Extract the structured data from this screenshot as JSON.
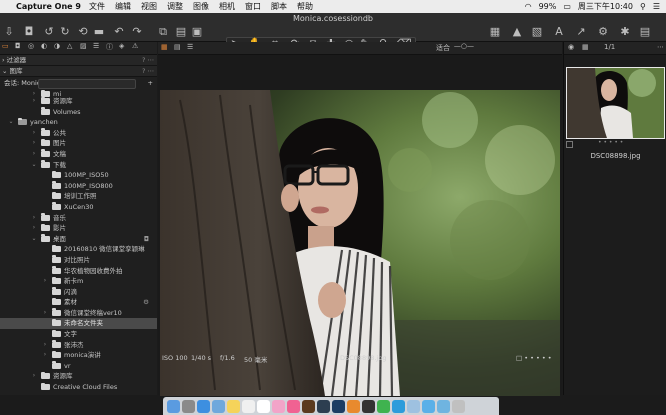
{
  "menubar": {
    "app_name": "Capture One 9",
    "items": [
      "文件",
      "编辑",
      "视图",
      "调整",
      "图像",
      "相机",
      "窗口",
      "脚本",
      "帮助"
    ],
    "battery": "99%",
    "clock": "周三下午10:40"
  },
  "window": {
    "title": "Monica.cosessiondb"
  },
  "tabbar": {
    "zoom_label": "适合",
    "counter": "1/1"
  },
  "sidebar": {
    "panels": {
      "filters_title": "过滤器",
      "library_title": "图库"
    },
    "session_label": "会话: Monica",
    "tree": [
      {
        "label": "mi",
        "indent": 1,
        "arrow": "›",
        "partial": true
      },
      {
        "label": "资源库",
        "indent": 1,
        "arrow": "›"
      },
      {
        "label": "Volumes",
        "indent": 1,
        "arrow": ""
      },
      {
        "label": "yanchen",
        "indent": 0,
        "arrow": "⌄"
      },
      {
        "label": "公共",
        "indent": 1,
        "arrow": "›"
      },
      {
        "label": "图片",
        "indent": 1,
        "arrow": "›"
      },
      {
        "label": "文稿",
        "indent": 1,
        "arrow": "›"
      },
      {
        "label": "下载",
        "indent": 1,
        "arrow": "⌄"
      },
      {
        "label": "100MP_ISO50",
        "indent": 2,
        "arrow": ""
      },
      {
        "label": "100MP_ISO800",
        "indent": 2,
        "arrow": ""
      },
      {
        "label": "培训工作照",
        "indent": 2,
        "arrow": ""
      },
      {
        "label": "XuCen30",
        "indent": 2,
        "arrow": ""
      },
      {
        "label": "音乐",
        "indent": 1,
        "arrow": "›"
      },
      {
        "label": "影片",
        "indent": 1,
        "arrow": "›"
      },
      {
        "label": "桌面",
        "indent": 1,
        "arrow": "⌄",
        "extra": "camera"
      },
      {
        "label": "20160810 微信课堂孪颖琳",
        "indent": 2,
        "arrow": ""
      },
      {
        "label": "对比照片",
        "indent": 2,
        "arrow": ""
      },
      {
        "label": "华农植物园收费外拍",
        "indent": 2,
        "arrow": ""
      },
      {
        "label": "新卡m",
        "indent": 2,
        "arrow": "›"
      },
      {
        "label": "闪滴",
        "indent": 2,
        "arrow": ""
      },
      {
        "label": "素材",
        "indent": 2,
        "arrow": "",
        "extra": "gear"
      },
      {
        "label": "微信课堂终稿ver10",
        "indent": 2,
        "arrow": "›"
      },
      {
        "label": "未命名文件夹",
        "indent": 2,
        "arrow": "",
        "selected": true
      },
      {
        "label": "文字",
        "indent": 2,
        "arrow": ""
      },
      {
        "label": "张沛杰",
        "indent": 2,
        "arrow": "›"
      },
      {
        "label": "monica演讲",
        "indent": 2,
        "arrow": "›"
      },
      {
        "label": "vr",
        "indent": 2,
        "arrow": ""
      },
      {
        "label": "资源库",
        "indent": 1,
        "arrow": "›"
      },
      {
        "label": "Creative Cloud Files",
        "indent": 1,
        "arrow": ""
      }
    ]
  },
  "viewer": {
    "iso": "ISO 100",
    "shutter": "1/40 s",
    "aperture": "f/1.6",
    "focal": "50 毫米",
    "filename": "DSC08898.jpg"
  },
  "browser": {
    "thumb_name": "DSC08898.jpg"
  },
  "icons": {
    "toolbar_left": [
      "import-icon",
      "camera-icon",
      "undo-icon",
      "redo-icon",
      "reset-icon",
      "delete-icon",
      "undo-arrow-icon",
      "redo-arrow-icon",
      "copy-icon"
    ],
    "toolbar_center": [
      "cursor-icon",
      "hand-icon",
      "crop-icon",
      "rotate-icon",
      "keystone-icon",
      "heal-icon",
      "circle-icon",
      "brush-icon",
      "eyedropper-icon",
      "eraser-icon"
    ],
    "toolbar_right": [
      "grid-icon",
      "warning-icon",
      "overlay-icon",
      "text-icon",
      "export-icon",
      "process-icon",
      "settings-icon"
    ]
  },
  "dock": [
    "finder",
    "launchpad",
    "safari",
    "mail",
    "notes",
    "reminders",
    "calendar",
    "photos",
    "itunes",
    "bridge",
    "lightroom",
    "photoshop",
    "books",
    "capture-one",
    "wechat",
    "qq",
    "preview",
    "folder",
    "folder",
    "trash"
  ]
}
